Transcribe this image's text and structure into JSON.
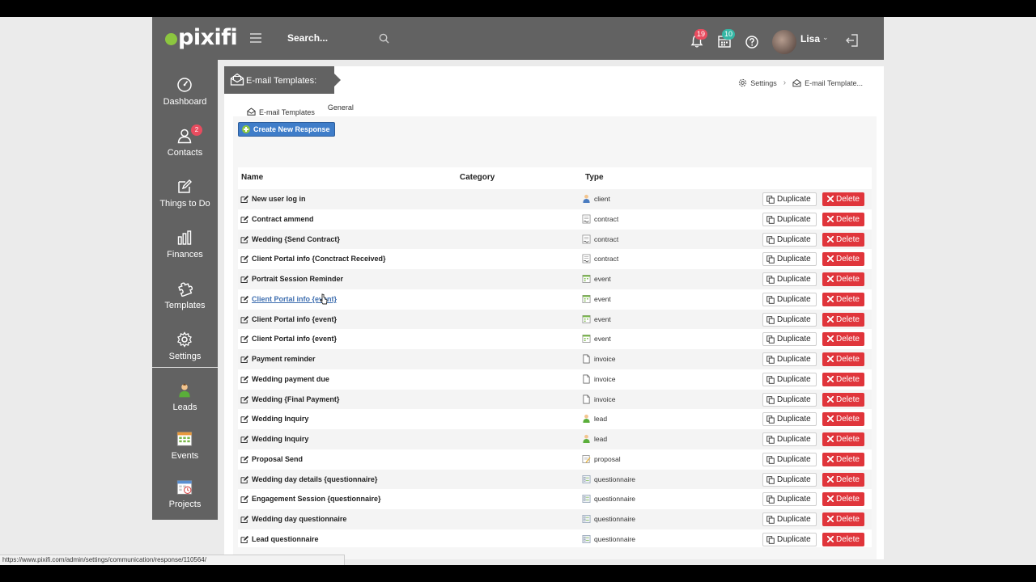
{
  "header": {
    "logo": "pixifi",
    "search_placeholder": "Search...",
    "notifications_count": "19",
    "calendar_count": "10",
    "user_name": "Lisa"
  },
  "sidebar": {
    "items": [
      {
        "label": "Dashboard"
      },
      {
        "label": "Contacts",
        "badge": "2"
      },
      {
        "label": "Things to Do"
      },
      {
        "label": "Finances"
      },
      {
        "label": "Templates"
      },
      {
        "label": "Settings"
      },
      {
        "label": "Leads"
      },
      {
        "label": "Events"
      },
      {
        "label": "Projects"
      }
    ]
  },
  "page": {
    "title": "E-mail Templates:",
    "breadcrumb": {
      "settings": "Settings",
      "current": "E-mail Template..."
    },
    "tabs": {
      "email_templates": "E-mail Templates",
      "general": "General"
    },
    "create_button": "Create New Response"
  },
  "table": {
    "headers": {
      "name": "Name",
      "category": "Category",
      "type": "Type"
    },
    "duplicate_label": "Duplicate",
    "delete_label": "Delete",
    "rows": [
      {
        "name": "New user log in",
        "type": "client",
        "icon": "client-icon"
      },
      {
        "name": "Contract ammend",
        "type": "contract",
        "icon": "contract-icon"
      },
      {
        "name": "Wedding {Send Contract}",
        "type": "contract",
        "icon": "contract-icon"
      },
      {
        "name": "Client Portal info {Conctract Received}",
        "type": "contract",
        "icon": "contract-icon"
      },
      {
        "name": "Portrait Session Reminder",
        "type": "event",
        "icon": "event-icon"
      },
      {
        "name": "Client Portal info {event}",
        "type": "event",
        "icon": "event-icon",
        "hovered": true
      },
      {
        "name": "Client Portal info {event}",
        "type": "event",
        "icon": "event-icon"
      },
      {
        "name": "Client Portal info {event}",
        "type": "event",
        "icon": "event-icon"
      },
      {
        "name": "Payment reminder",
        "type": "invoice",
        "icon": "invoice-icon"
      },
      {
        "name": "Wedding payment due",
        "type": "invoice",
        "icon": "invoice-icon"
      },
      {
        "name": "Wedding {Final Payment}",
        "type": "invoice",
        "icon": "invoice-icon"
      },
      {
        "name": "Wedding Inquiry",
        "type": "lead",
        "icon": "lead-icon"
      },
      {
        "name": "Wedding Inquiry",
        "type": "lead",
        "icon": "lead-icon"
      },
      {
        "name": "Proposal Send",
        "type": "proposal",
        "icon": "proposal-icon"
      },
      {
        "name": "Wedding day details {questionnaire}",
        "type": "questionnaire",
        "icon": "questionnaire-icon"
      },
      {
        "name": "Engagement Session {questionnaire}",
        "type": "questionnaire",
        "icon": "questionnaire-icon"
      },
      {
        "name": "Wedding day questionnaire",
        "type": "questionnaire",
        "icon": "questionnaire-icon"
      },
      {
        "name": "Lead questionnaire",
        "type": "questionnaire",
        "icon": "questionnaire-icon"
      }
    ]
  },
  "status_bar": {
    "url": "https://www.pixifi.com/admin/settings/communication/response/110564/"
  },
  "colors": {
    "chrome_gray": "#626262",
    "create_blue": "#3f7dc9",
    "delete_red": "#e0353b",
    "badge_red": "#e84c5f",
    "badge_teal": "#35b7a5",
    "logo_green": "#8cc63f"
  }
}
